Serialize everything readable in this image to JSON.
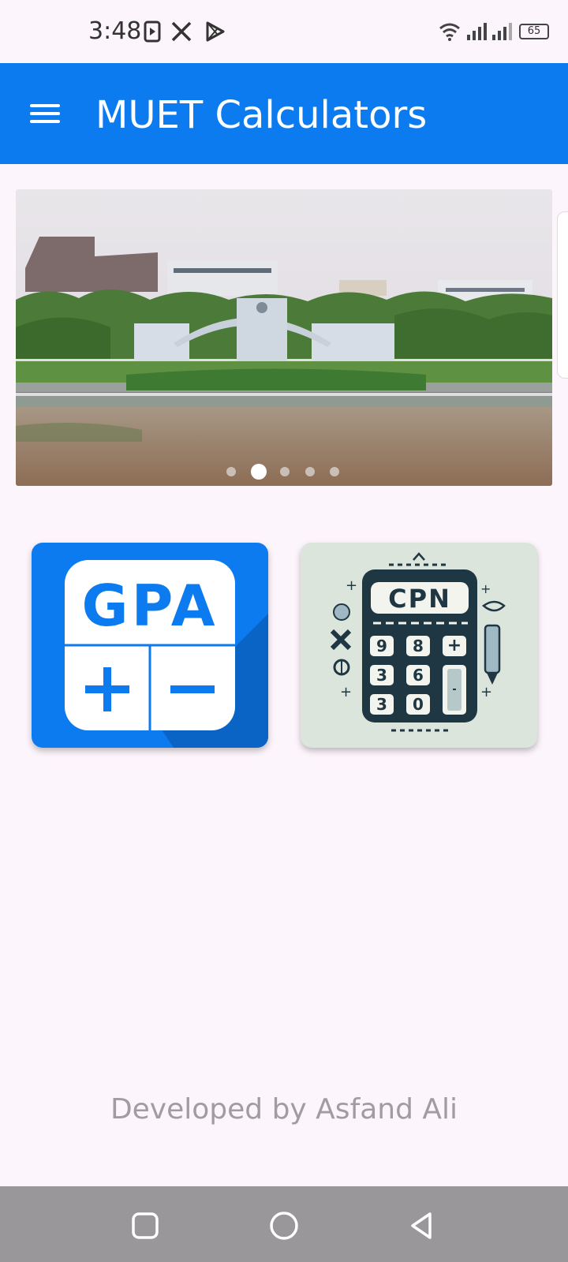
{
  "status_bar": {
    "time": "3:48",
    "left_icons": [
      "media-play-icon",
      "x-logo-icon",
      "play-store-icon"
    ],
    "right_icons": [
      "wifi-icon",
      "signal-icon",
      "signal-icon-2",
      "battery-icon"
    ],
    "battery_level": "65"
  },
  "app_bar": {
    "title": "MUET Calculators",
    "menu_icon": "hamburger-menu-icon",
    "color": "#0d7bf0"
  },
  "carousel": {
    "image": "MUET campus entrance gate photo",
    "active_index": 1,
    "slide_count": 5
  },
  "cards": [
    {
      "name": "gpa-calculator",
      "logo_text": "GPA",
      "symbols": [
        "+",
        "−"
      ]
    },
    {
      "name": "cpn-calculator",
      "logo_text": "CPN",
      "keys": [
        "9",
        "8",
        "+",
        "3",
        "6",
        "3",
        "0"
      ]
    }
  ],
  "footer": {
    "text": "Developed by Asfand Ali"
  },
  "nav_bar": {
    "buttons": [
      "recents-button",
      "home-button",
      "back-button"
    ]
  }
}
